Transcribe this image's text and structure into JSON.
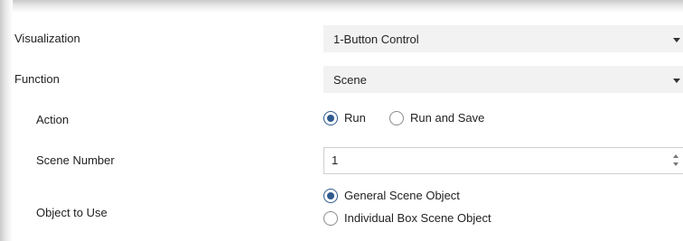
{
  "rows": {
    "visualization": {
      "label": "Visualization",
      "value": "1-Button Control"
    },
    "function": {
      "label": "Function",
      "value": "Scene"
    },
    "action": {
      "label": "Action",
      "options": [
        "Run",
        "Run and Save"
      ],
      "selected": "Run"
    },
    "scene_number": {
      "label": "Scene Number",
      "value": "1"
    },
    "object_to_use": {
      "label": "Object to Use",
      "options": [
        "General Scene Object",
        "Individual Box Scene Object"
      ],
      "selected": "General Scene Object"
    }
  },
  "icons": {
    "dropdown": "chevron-down-icon",
    "spin_up": "arrow-up-icon",
    "spin_down": "arrow-down-icon"
  },
  "colors": {
    "accent": "#2f5a8f",
    "combo_bg": "#f2f2f2",
    "input_border": "#cfcfcf"
  }
}
